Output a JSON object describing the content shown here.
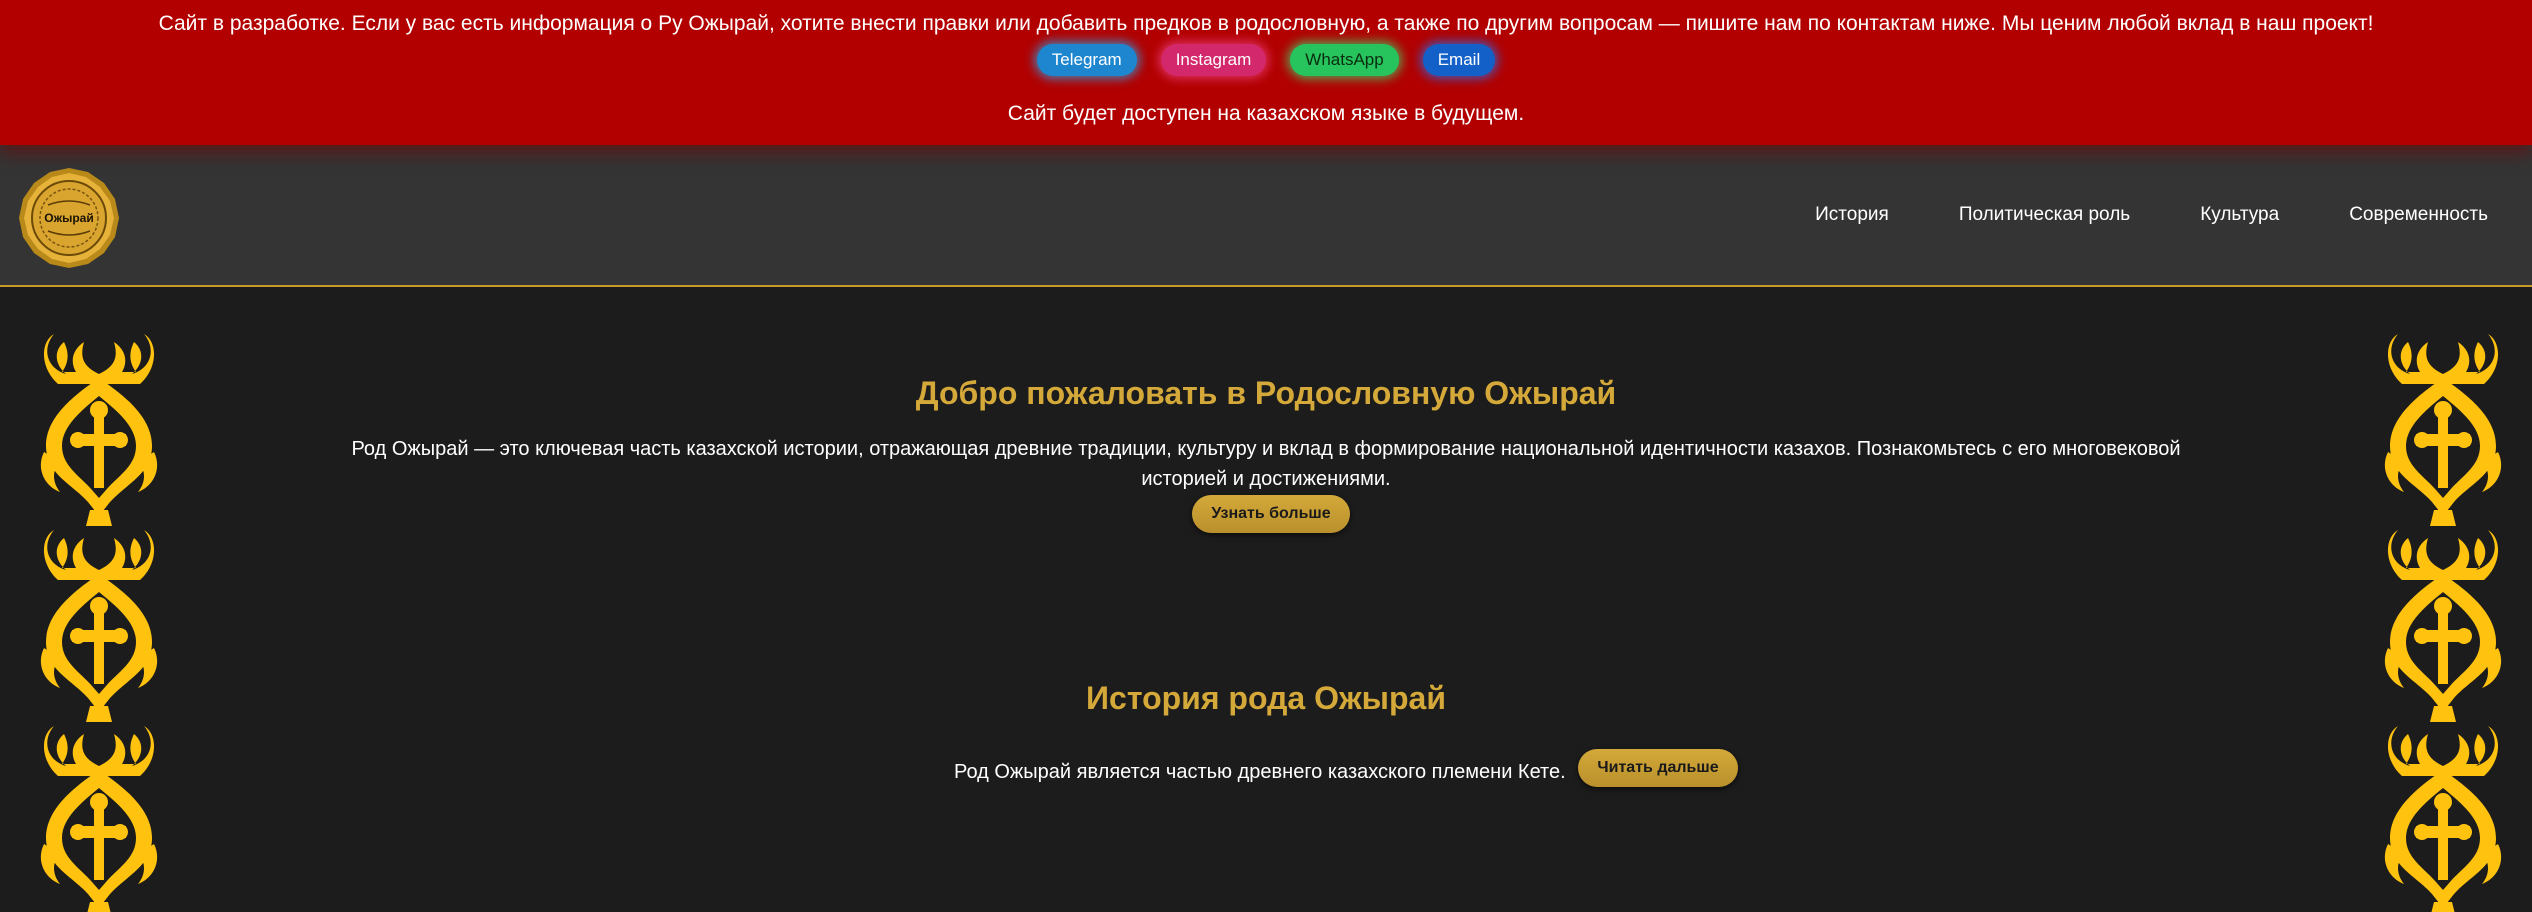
{
  "banner": {
    "message": "Сайт в разработке. Если у вас есть информация о Ру Ожырай, хотите внести правки или добавить предков в родословную, а также по другим вопросам — пишите нам по контактам ниже. Мы ценим любой вклад в наш проект!",
    "contacts": {
      "telegram": "Telegram",
      "instagram": "Instagram",
      "whatsapp": "WhatsApp",
      "email": "Email"
    },
    "note": "Сайт будет доступен на казахском языке в будущем."
  },
  "header": {
    "logo_text": "Ожырай",
    "nav": {
      "history": "История",
      "politics": "Политическая роль",
      "culture": "Культура",
      "modern": "Современность"
    }
  },
  "hero": {
    "title": "Добро пожаловать в Родословную Ожырай",
    "text": "Род Ожырай — это ключевая часть казахской истории, отражающая древние традиции, культуру и вклад в формирование национальной идентичности казахов. Познакомьтесь с его многовековой историей и достижениями.",
    "button": "Узнать больше"
  },
  "history": {
    "title": "История рода Ожырай",
    "text": "Род Ожырай является частью древнего казахского племени Кете.",
    "button": "Читать дальше"
  },
  "colors": {
    "banner_bg": "#b20000",
    "header_bg": "#343434",
    "page_bg": "#1c1c1c",
    "accent_gold": "#d4a93a",
    "ornament_yellow": "#ffc20e"
  }
}
